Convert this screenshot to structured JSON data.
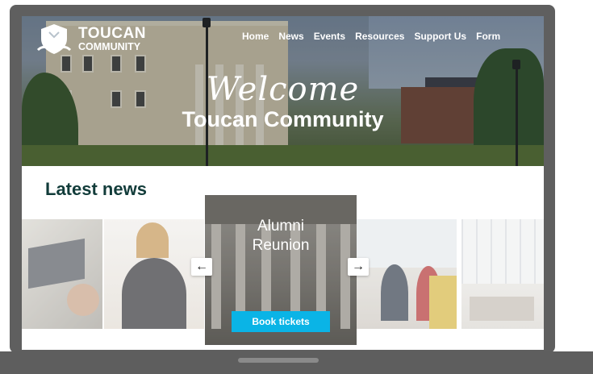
{
  "brand": {
    "name_line1": "TOUCAN",
    "name_line2": "COMMUNITY"
  },
  "nav": {
    "items": [
      "Home",
      "News",
      "Events",
      "Resources",
      "Support Us",
      "Form"
    ]
  },
  "hero": {
    "welcome": "Welcome",
    "tagline": "Toucan Community"
  },
  "news": {
    "heading": "Latest news",
    "featured": {
      "title_line1": "Alumni",
      "title_line2": "Reunion",
      "button_label": "Book tickets"
    }
  },
  "icons": {
    "prev": "arrow-left-icon",
    "next": "arrow-right-icon",
    "logo": "shield-crest-icon"
  },
  "colors": {
    "accent": "#0ab4e6",
    "heading": "#123c3a",
    "laptop_frame": "#5f5f5f"
  }
}
